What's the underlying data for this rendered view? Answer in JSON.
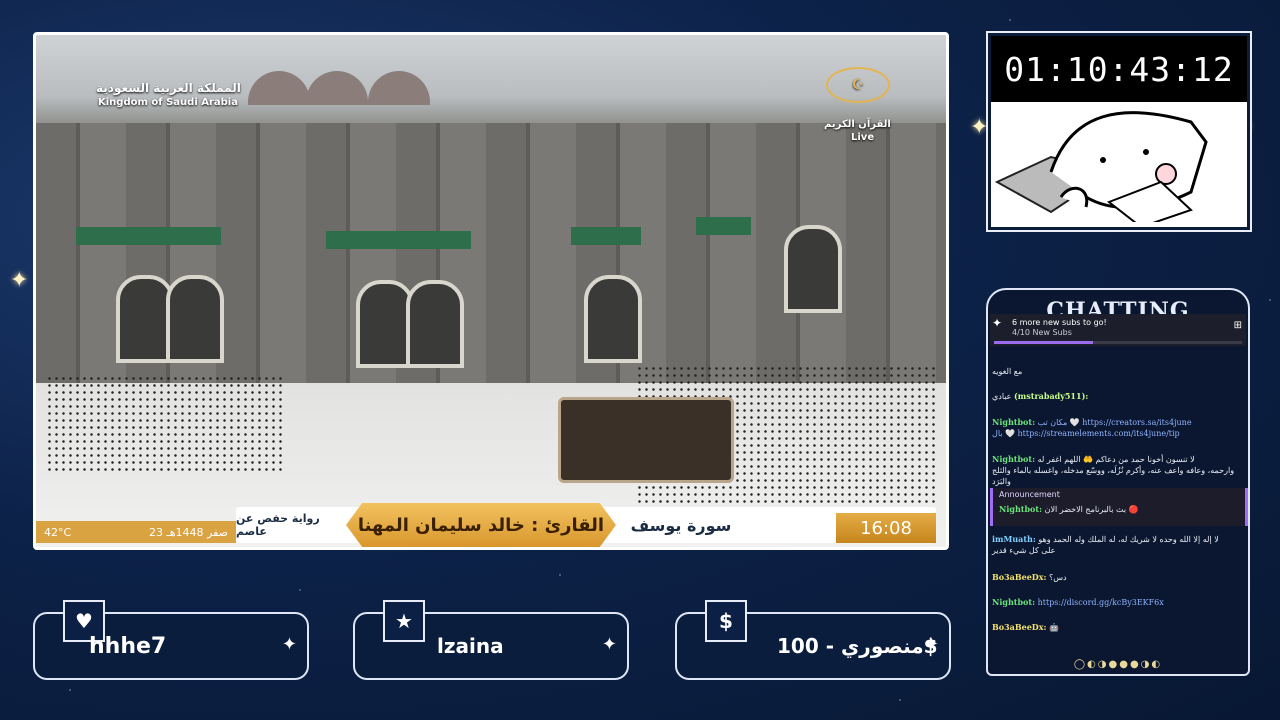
{
  "video": {
    "country_ar": "المملكة العربية السعودية",
    "country_en": "Kingdom of Saudi Arabia",
    "channel_ar": "القرآن الكريم",
    "live": "Live",
    "reciter": "القارئ : خالد سليمان المهنا",
    "surah": "سورة يوسف",
    "riwaya": "رواية حفص عن عاصم",
    "date": "23 صفر 1448هـ",
    "temp": "42°C",
    "time": "16:08"
  },
  "timer": {
    "value": "01:10:43:12"
  },
  "chat": {
    "title": "CHATTING",
    "goal_text": "6 more new subs to go!",
    "goal_count": "4/10 New Subs",
    "goal_fraction": 0.4,
    "messages": [
      {
        "user": "",
        "text": "مع الغويه"
      },
      {
        "user": "(mstrabady511):",
        "text": "عبادي"
      },
      {
        "user": "Nightbot:",
        "text": "مكان تب 🤍 https://creators.sa/its4june",
        "text2": "بال 🤍 https://streamelements.com/its4june/tip"
      },
      {
        "user": "Nightbot:",
        "text": "لا تنسون أخونا حمد من دعاكم 🤲 اللهم اغفر له",
        "text2": "وارحمه، وعافه واعف عنه، وأكرم نُزُلَه، ووسّع مدخله، واغسله بالماء والثلج والبَرَد"
      },
      {
        "user": "Nightbot:",
        "text": "بث بالبرنامج الاخضر الان 🔴"
      },
      {
        "user": "imMuath:",
        "text": "لا إله إلا الله وحده لا شريك له، له الملك وله الحمد وهو",
        "text2": "على كل شيء قدير"
      },
      {
        "user": "Bo3aBeeDx:",
        "text": "دس؟"
      },
      {
        "user": "Nightbot:",
        "text": "https://discord.gg/kcBy3EKF6x"
      },
      {
        "user": "Bo3aBeeDx:",
        "text": "🤖"
      }
    ],
    "announcement_label": "Announcement"
  },
  "alerts": [
    {
      "icon": "heart-icon",
      "glyph": "♥",
      "value": "hhhe7"
    },
    {
      "icon": "star-icon",
      "glyph": "★",
      "value": "lzaina"
    },
    {
      "icon": "dollar-icon",
      "glyph": "$",
      "value": "منصوري - 100$"
    }
  ]
}
